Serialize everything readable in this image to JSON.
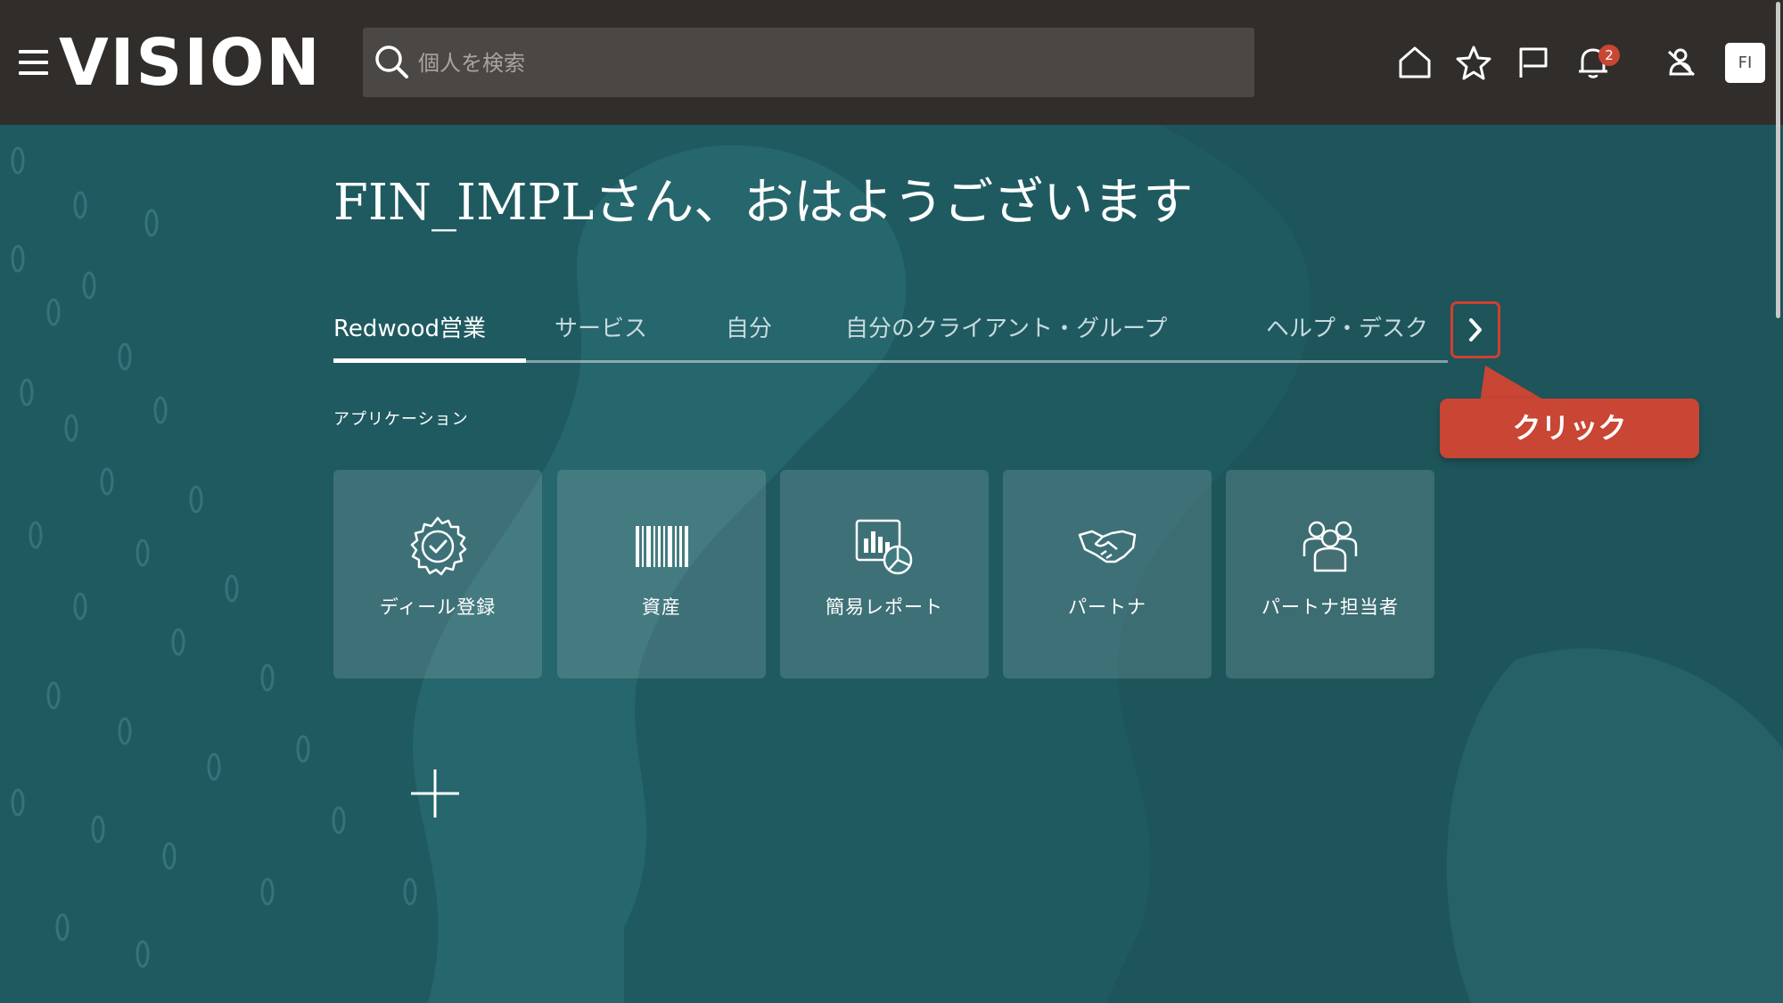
{
  "header": {
    "logo": "VISION",
    "search_placeholder": "個人を検索",
    "notification_count": "2",
    "avatar_initials": "FI",
    "icons": [
      "menu-icon",
      "search-icon",
      "home-icon",
      "star-icon",
      "flag-icon",
      "bell-icon",
      "accessibility-icon"
    ]
  },
  "main": {
    "greeting": "FIN_IMPLさん、おはようございます",
    "tabs": [
      "Redwood営業",
      "サービス",
      "自分",
      "自分のクライアント・グループ",
      "ヘルプ・デスク"
    ],
    "active_tab": "Redwood営業",
    "section_label": "アプリケーション",
    "tiles": [
      {
        "label": "ディール登録",
        "icon": "badge-check-icon"
      },
      {
        "label": "資産",
        "icon": "barcode-icon"
      },
      {
        "label": "簡易レポート",
        "icon": "report-chart-icon"
      },
      {
        "label": "パートナ",
        "icon": "handshake-icon"
      },
      {
        "label": "パートナ担当者",
        "icon": "group-icon"
      }
    ],
    "add_icon": "plus-icon"
  },
  "callout": {
    "text": "クリック"
  },
  "colors": {
    "header_bg": "#312d2a",
    "page_bg": "#1f5a61",
    "accent_red": "#c94534",
    "badge_red": "#c74634"
  }
}
